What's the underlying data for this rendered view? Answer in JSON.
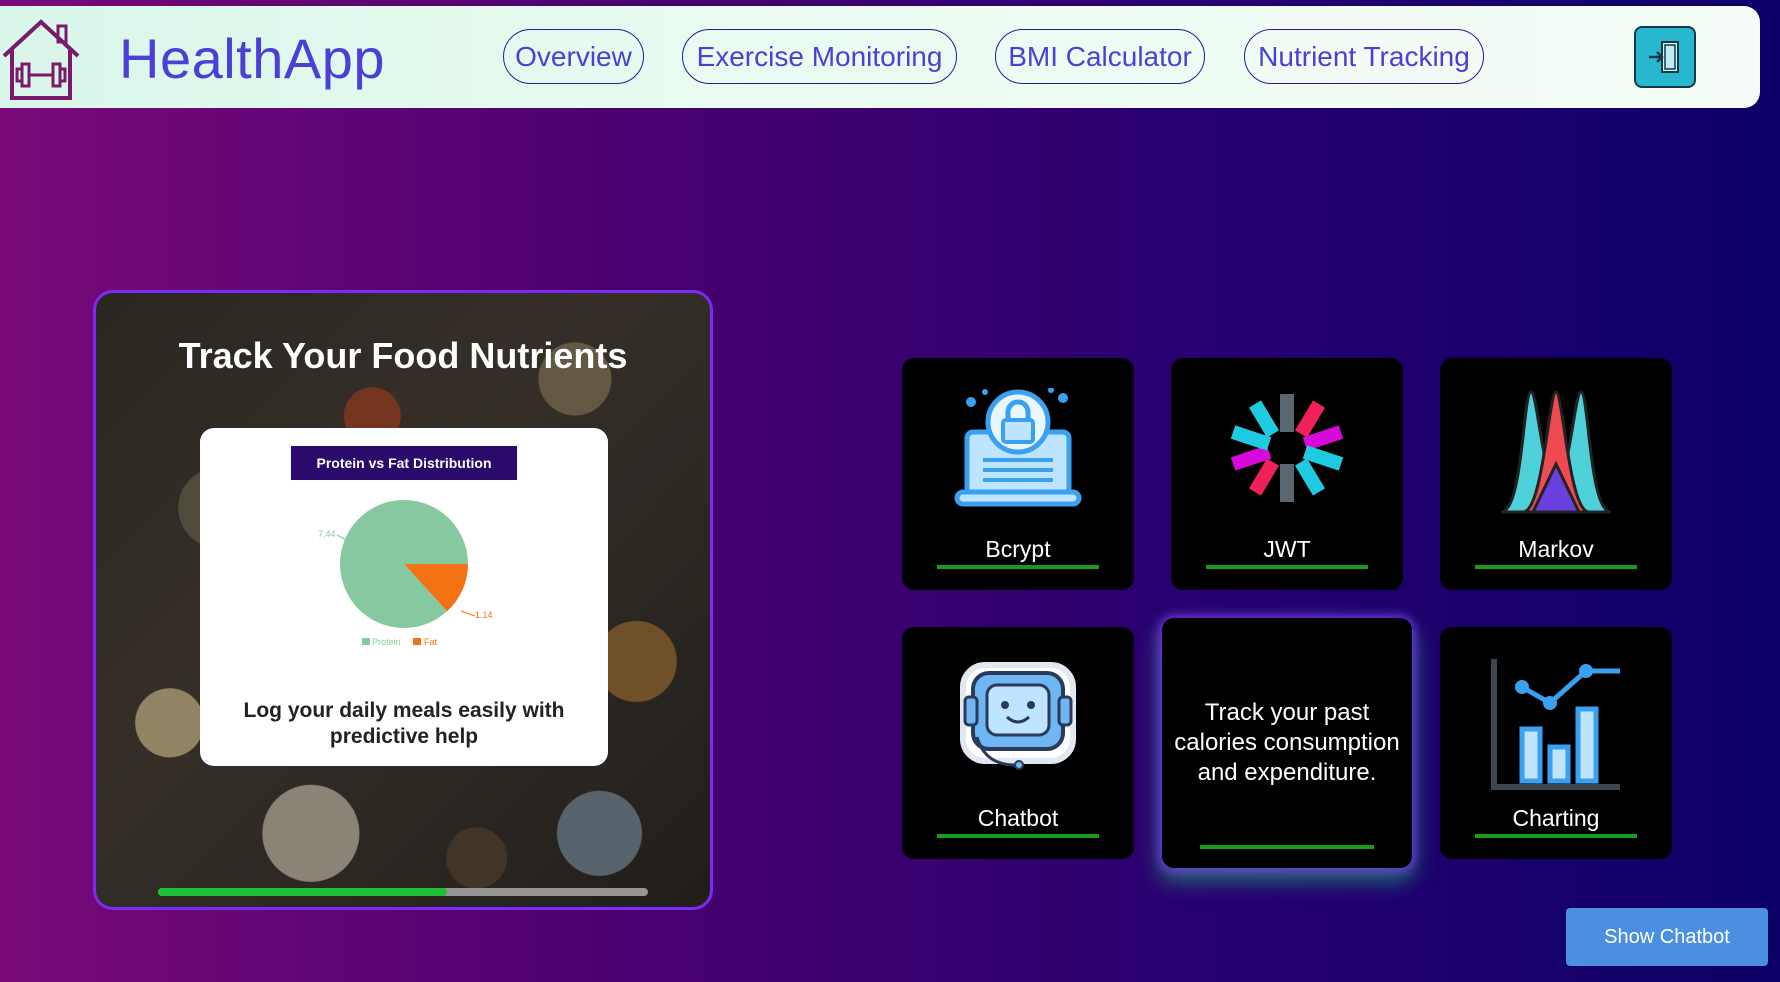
{
  "header": {
    "brand": "HealthApp",
    "nav": [
      "Overview",
      "Exercise Monitoring",
      "BMI Calculator",
      "Nutrient Tracking"
    ],
    "home_icon": "home-dumbbell-icon",
    "logout_icon": "door-enter-icon"
  },
  "slide": {
    "title": "Track Your Food Nutrients",
    "caption": "Log your daily meals easily with predictive help",
    "progress": 0.59
  },
  "chart_data": {
    "type": "pie",
    "title": "Protein vs Fat Distribution",
    "categories": [
      "Protein",
      "Fat"
    ],
    "values": [
      7.44,
      1.14
    ],
    "data_labels": [
      "7.44",
      "1.14"
    ],
    "colors": [
      "#86c9a0",
      "#f37314"
    ],
    "legend": "bottom"
  },
  "tiles": [
    {
      "label": "Bcrypt",
      "icon": "lock-laptop-icon"
    },
    {
      "label": "JWT",
      "icon": "jwt-icon"
    },
    {
      "label": "Markov",
      "icon": "distribution-curves-icon"
    },
    {
      "label": "Chatbot",
      "icon": "robot-icon"
    },
    {
      "label": "",
      "description": "Track your past calories consumption and expenditure."
    },
    {
      "label": "Charting",
      "icon": "bar-line-chart-icon"
    }
  ],
  "chatbot_button": "Show Chatbot",
  "colors": {
    "accent": "#4b3fd6",
    "underline": "#1a9a1a",
    "progress": "#1fbf3a"
  }
}
